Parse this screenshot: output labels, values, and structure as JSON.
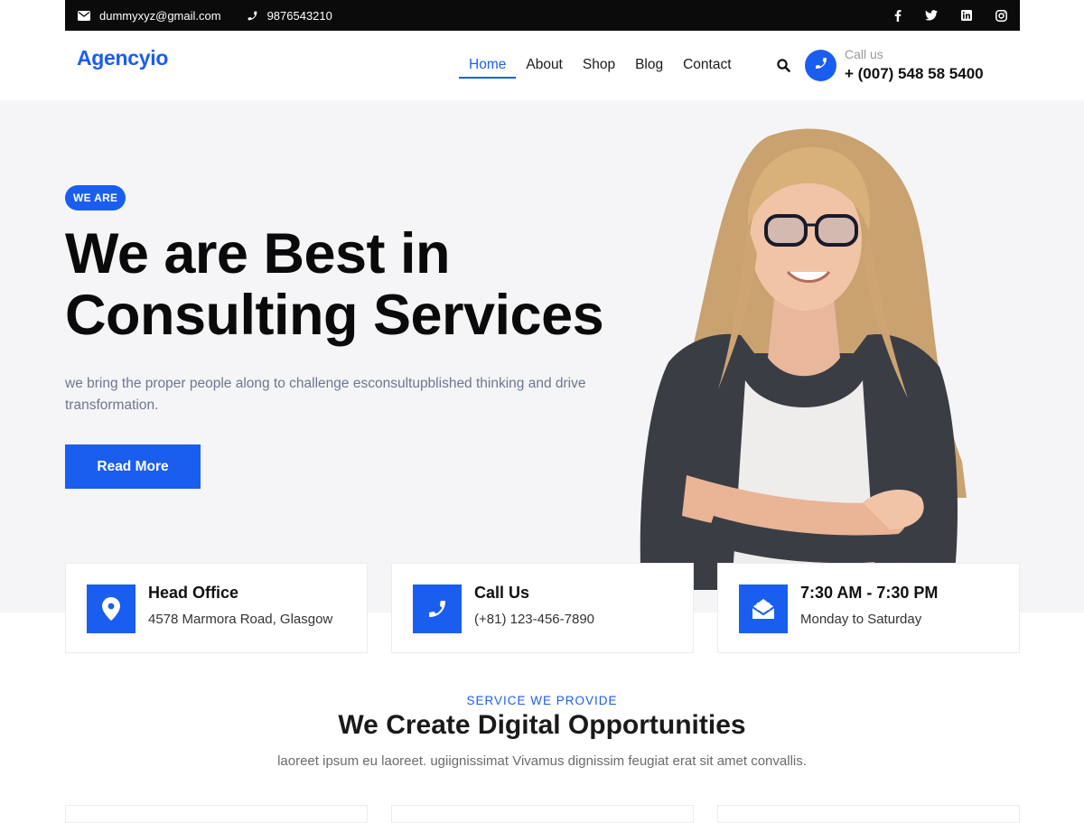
{
  "topbar": {
    "email": "dummyxyz@gmail.com",
    "phone": "9876543210",
    "social": [
      "facebook-icon",
      "twitter-icon",
      "linkedin-icon",
      "instagram-icon"
    ]
  },
  "header": {
    "logo": "Agencyio",
    "nav": [
      {
        "label": "Home",
        "active": true
      },
      {
        "label": "About",
        "active": false
      },
      {
        "label": "Shop",
        "active": false
      },
      {
        "label": "Blog",
        "active": false
      },
      {
        "label": "Contact",
        "active": false
      }
    ],
    "call_label": "Call us",
    "call_number": "+ (007) 548 58 5400"
  },
  "hero": {
    "badge": "WE ARE",
    "title": "We are Best in Consulting Services",
    "description": "we bring the proper people along to challenge esconsultupblished thinking and drive transformation.",
    "button": "Read More"
  },
  "cards": [
    {
      "title": "Head Office",
      "text": "4578 Marmora Road, Glasgow",
      "icon": "location-pin-icon"
    },
    {
      "title": "Call Us",
      "text": "(+81) 123-456-7890",
      "icon": "phone-icon"
    },
    {
      "title": "7:30 AM - 7:30 PM",
      "text": "Monday to Saturday",
      "icon": "envelope-open-icon"
    }
  ],
  "services": {
    "eyebrow": "SERVICE WE PROVIDE",
    "title": "We Create Digital Opportunities",
    "description": "laoreet ipsum eu laoreet. ugiignissimat Vivamus dignissim feugiat erat sit amet convallis."
  },
  "colors": {
    "accent": "#1a5ef0",
    "topbar": "#0b0b0b",
    "hero_bg": "#f5f5f7"
  }
}
